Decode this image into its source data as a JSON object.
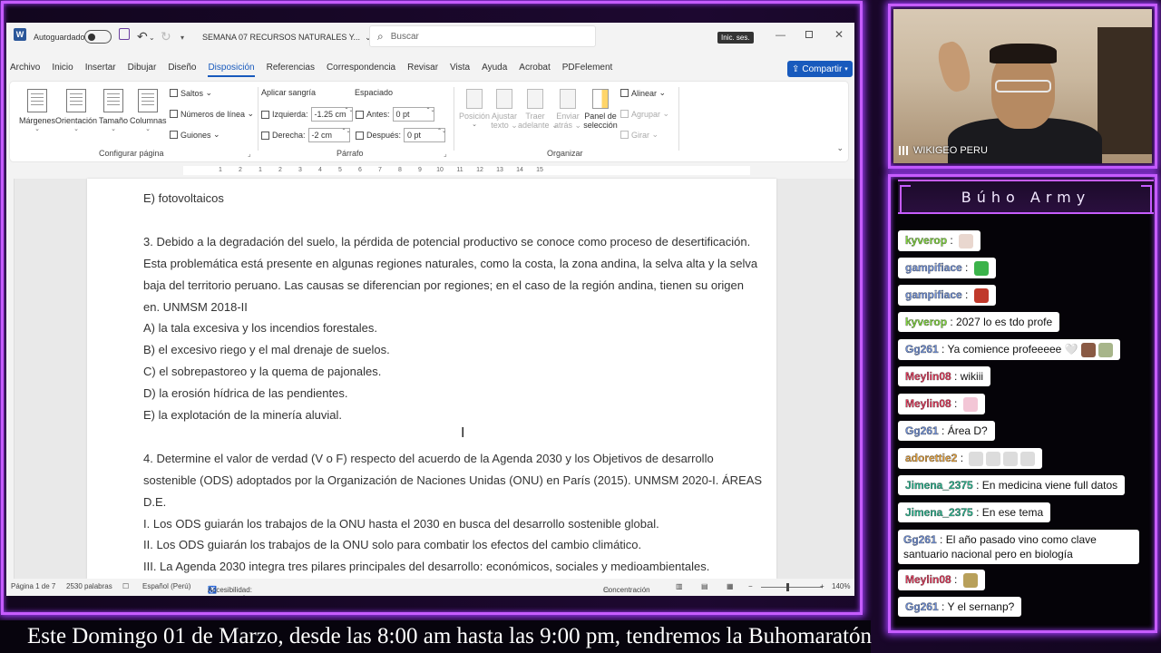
{
  "word": {
    "autosave_label": "Autoguardado",
    "doc_title": "SEMANA 07 RECURSOS NATURALES Y...",
    "search_placeholder": "Buscar",
    "signin": "Inic. ses.",
    "menu": [
      "Archivo",
      "Inicio",
      "Insertar",
      "Dibujar",
      "Diseño",
      "Disposición",
      "Referencias",
      "Correspondencia",
      "Revisar",
      "Vista",
      "Ayuda",
      "Acrobat",
      "PDFelement"
    ],
    "active_menu": "Disposición",
    "share_label": "Compartir",
    "ribbon": {
      "margins": "Márgenes",
      "orientation": "Orientación",
      "size": "Tamaño",
      "columns": "Columnas",
      "breaks": "Saltos",
      "line_numbers": "Números de línea",
      "hyphenation": "Guiones",
      "page_setup_group": "Configurar página",
      "indent_title": "Aplicar sangría",
      "indent_left_label": "Izquierda:",
      "indent_left_value": "-1.25 cm",
      "indent_right_label": "Derecha:",
      "indent_right_value": "-2 cm",
      "spacing_title": "Espaciado",
      "spacing_before_label": "Antes:",
      "spacing_before_value": "0 pt",
      "spacing_after_label": "Después:",
      "spacing_after_value": "0 pt",
      "paragraph_group": "Párrafo",
      "position": "Posición",
      "wrap_text_1": "Ajustar",
      "wrap_text_2": "texto",
      "bring_forward_1": "Traer",
      "bring_forward_2": "adelante",
      "send_backward_1": "Enviar",
      "send_backward_2": "atrás",
      "selection_pane_1": "Panel de",
      "selection_pane_2": "selección",
      "align": "Alinear",
      "group": "Agrupar",
      "rotate": "Girar",
      "arrange_group": "Organizar"
    },
    "ruler_numbers": [
      "1",
      "2",
      "1",
      "2",
      "3",
      "4",
      "5",
      "6",
      "7",
      "8",
      "9",
      "10",
      "11",
      "12",
      "13",
      "14",
      "15"
    ],
    "document_lines": [
      "E) fotovoltaicos",
      "",
      "3. Debido a la degradación del suelo, la pérdida de potencial productivo se conoce como proceso de desertificación.",
      "Esta problemática está presente en algunas regiones naturales, como la costa, la zona andina, la selva alta y la selva",
      "baja del territorio peruano. Las causas se diferencian por regiones; en el caso de la región andina, tienen su origen",
      "en. UNMSM 2018-II",
      "A) la tala excesiva y los incendios forestales.",
      "B) el excesivo riego y el mal drenaje de suelos.",
      "C) el sobrepastoreo y la quema de pajonales.",
      "D) la erosión hídrica de las pendientes.",
      "E) la explotación de la minería aluvial.",
      "",
      "4. Determine el valor de verdad (V o F) respecto del acuerdo de la Agenda 2030 y los Objetivos de desarrollo",
      "sostenible (ODS) adoptados por la Organización de Naciones Unidas (ONU) en París (2015). UNMSM 2020-I. ÁREAS",
      "D.E.",
      "I. Los ODS guiarán los trabajos de la ONU hasta el 2030 en busca del desarrollo sostenible global.",
      "II. Los ODS guiarán los trabajos de la ONU solo para combatir los efectos del cambio climático.",
      "III. La Agenda 2030 integra tres pilares principales del desarrollo: económicos, sociales y medioambientales."
    ],
    "status": {
      "page": "Página 1 de 7",
      "words": "2530 palabras",
      "language": "Español (Perú)",
      "accessibility": "Accesibilidad: es necesario investigar",
      "focus": "Concentración",
      "zoom": "140%"
    }
  },
  "cam": {
    "label": "WIKIGEO PERU"
  },
  "chat": {
    "title": "Búho Army",
    "messages": [
      {
        "user": "kyverop",
        "text": "",
        "color": "#7fd63b",
        "emotes": [
          "#e9d7cf"
        ]
      },
      {
        "user": "gampifiace",
        "text": "",
        "color": "#6f8fd6",
        "emotes": [
          "#3bb34a"
        ]
      },
      {
        "user": "gampifiace",
        "text": "",
        "color": "#6f8fd6",
        "emotes": [
          "#c0392b"
        ]
      },
      {
        "user": "kyverop",
        "text": "2027 lo es tdo profe",
        "color": "#7fd63b",
        "emotes": []
      },
      {
        "user": "Gg261",
        "text": "Ya comience profeeeee 🤍",
        "color": "#6f8fd6",
        "emotes": [
          "#8a5a44",
          "#a7b58a"
        ]
      },
      {
        "user": "Meylin08",
        "text": "wikiii",
        "color": "#e0395a",
        "emotes": []
      },
      {
        "user": "Meylin08",
        "text": "",
        "color": "#e0395a",
        "emotes": [
          "#f3c6d6"
        ]
      },
      {
        "user": "Gg261",
        "text": "Área D?",
        "color": "#6f8fd6",
        "emotes": []
      },
      {
        "user": "adorettie2",
        "text": "",
        "color": "#e6a23c",
        "emotes": [
          "#dcdcdc",
          "#dcdcdc",
          "#dcdcdc",
          "#dcdcdc"
        ]
      },
      {
        "user": "Jimena_2375",
        "text": "En medicina viene full datos",
        "color": "#2bb58f",
        "emotes": []
      },
      {
        "user": "Jimena_2375",
        "text": "En ese tema",
        "color": "#2bb58f",
        "emotes": []
      },
      {
        "user": "Gg261",
        "text": "El año pasado vino como clave santuario nacional pero en biología",
        "color": "#6f8fd6",
        "emotes": []
      },
      {
        "user": "Meylin08",
        "text": "",
        "color": "#e0395a",
        "emotes": [
          "#b8a05a"
        ]
      },
      {
        "user": "Gg261",
        "text": "Y el sernanp?",
        "color": "#6f8fd6",
        "emotes": []
      }
    ]
  },
  "ticker": {
    "text": "Este Domingo 01 de Marzo, desde las 8:00 am hasta las 9:00 pm, tendremos la Buhomaratón"
  }
}
